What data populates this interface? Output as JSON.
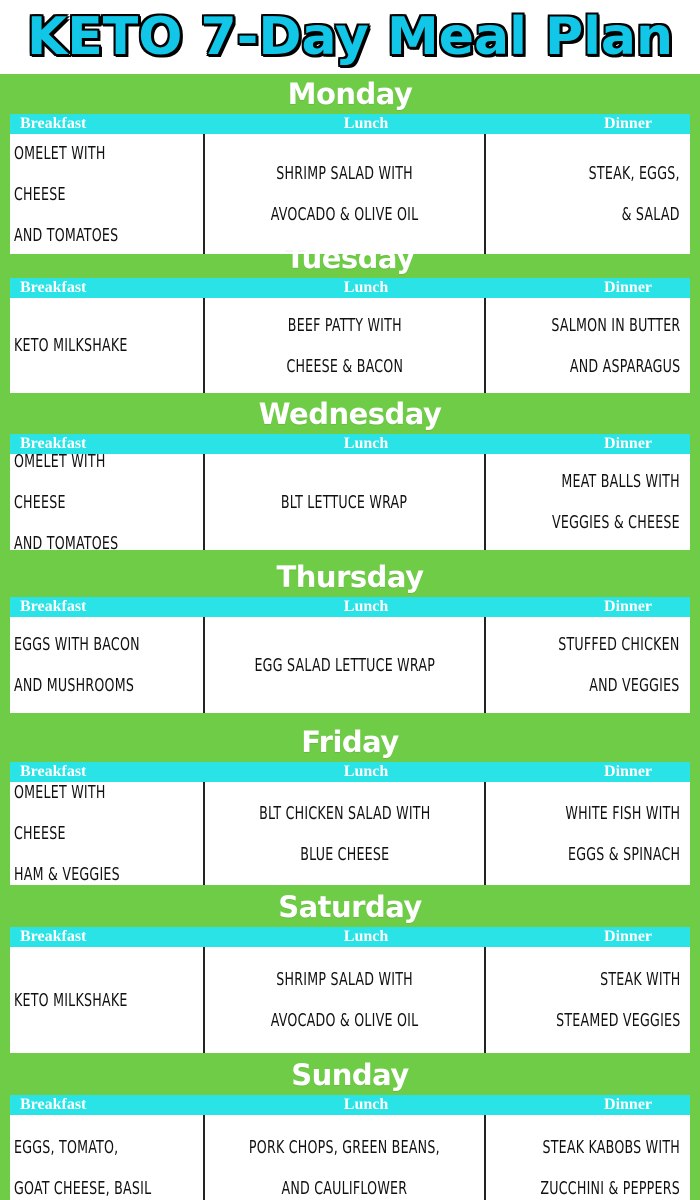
{
  "title": "KETO 7-Day Meal Plan",
  "colors": {
    "green": "#6fcc47",
    "cyan": "#29e3e6",
    "title": "#11c6e6"
  },
  "headers": {
    "breakfast": "Breakfast",
    "lunch": "Lunch",
    "dinner": "Dinner"
  },
  "days": [
    {
      "name": "Monday",
      "breakfast": "OMELET WITH CHEESE\nAND TOMATOES",
      "lunch": "SHRIMP SALAD WITH\nAVOCADO & OLIVE OIL",
      "dinner": "STEAK, EGGS,\n& SALAD"
    },
    {
      "name": "Tuesday",
      "breakfast": "KETO MILKSHAKE",
      "lunch": "BEEF PATTY WITH\nCHEESE & BACON",
      "dinner": "SALMON IN BUTTER\nAND ASPARAGUS"
    },
    {
      "name": "Wednesday",
      "breakfast": "OMELET WITH CHEESE\nAND TOMATOES",
      "lunch": "BLT LETTUCE WRAP",
      "dinner": "MEAT BALLS WITH\nVEGGIES & CHEESE"
    },
    {
      "name": "Thursday",
      "breakfast": "EGGS WITH BACON\nAND MUSHROOMS",
      "lunch": "EGG SALAD LETTUCE WRAP",
      "dinner": "STUFFED CHICKEN\nAND VEGGIES"
    },
    {
      "name": "Friday",
      "breakfast": "OMELET WITH CHEESE\nHAM & VEGGIES",
      "lunch": "BLT CHICKEN SALAD WITH\nBLUE CHEESE",
      "dinner": "WHITE FISH WITH\nEGGS & SPINACH"
    },
    {
      "name": "Saturday",
      "breakfast": "KETO MILKSHAKE",
      "lunch": "SHRIMP SALAD WITH\nAVOCADO & OLIVE OIL",
      "dinner": "STEAK WITH\nSTEAMED VEGGIES"
    },
    {
      "name": "Sunday",
      "breakfast": "EGGS, TOMATO,\nGOAT CHEESE, BASIL",
      "lunch": "PORK CHOPS, GREEN BEANS,\nAND CAULIFLOWER",
      "dinner": "STEAK KABOBS WITH\nZUCCHINI & PEPPERS"
    }
  ]
}
